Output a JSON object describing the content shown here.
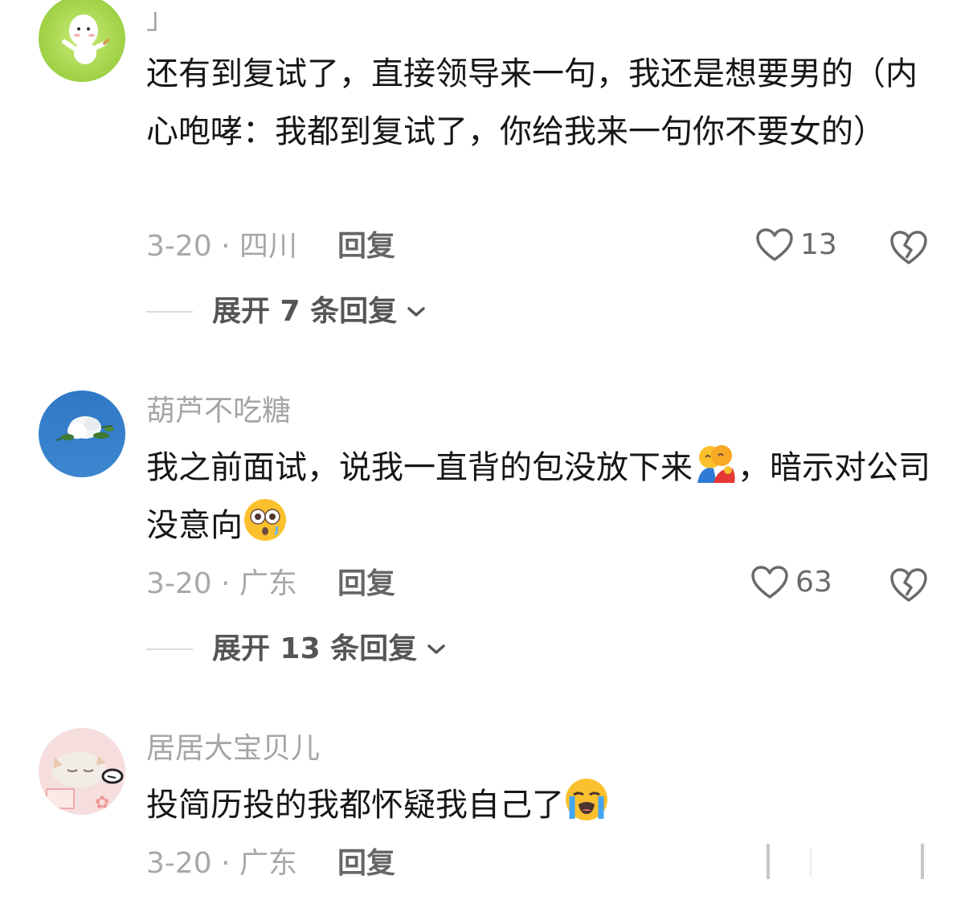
{
  "comments": [
    {
      "username": "」",
      "text": "还有到复试了，直接领导来一句，我还是想要男的（内心咆哮：我都到复试了，你给我来一句你不要女的）",
      "date_location": "3-20 · 四川",
      "reply_label": "回复",
      "likes": "13",
      "expand_label": "展开 7 条回复",
      "avatar_icon": "cartoon-dancing-sprite-avatar"
    },
    {
      "username": "葫芦不吃糖",
      "text_before_emoji": "我之前面试，说我一直背的包没放下来",
      "text_middle": "，暗示对公司没意向",
      "emoji_1": "people-hugging-emoji",
      "emoji_2": "flushed-face-emoji",
      "date_location": "3-20 · 广东",
      "reply_label": "回复",
      "likes": "63",
      "expand_label": "展开 13 条回复",
      "avatar_icon": "white-flower-blue-sky-avatar"
    },
    {
      "username": "居居大宝贝儿",
      "text": "投简历投的我都怀疑我自己了",
      "emoji": "loudly-crying-face-emoji",
      "date_location": "3-20 · 广东",
      "reply_label": "回复",
      "avatar_icon": "sleeping-cat-sticker-avatar"
    }
  ],
  "colors": {
    "meta_gray": "#a8a8a8",
    "text_dark": "#161616",
    "icon_gray": "#6a6a6a"
  }
}
